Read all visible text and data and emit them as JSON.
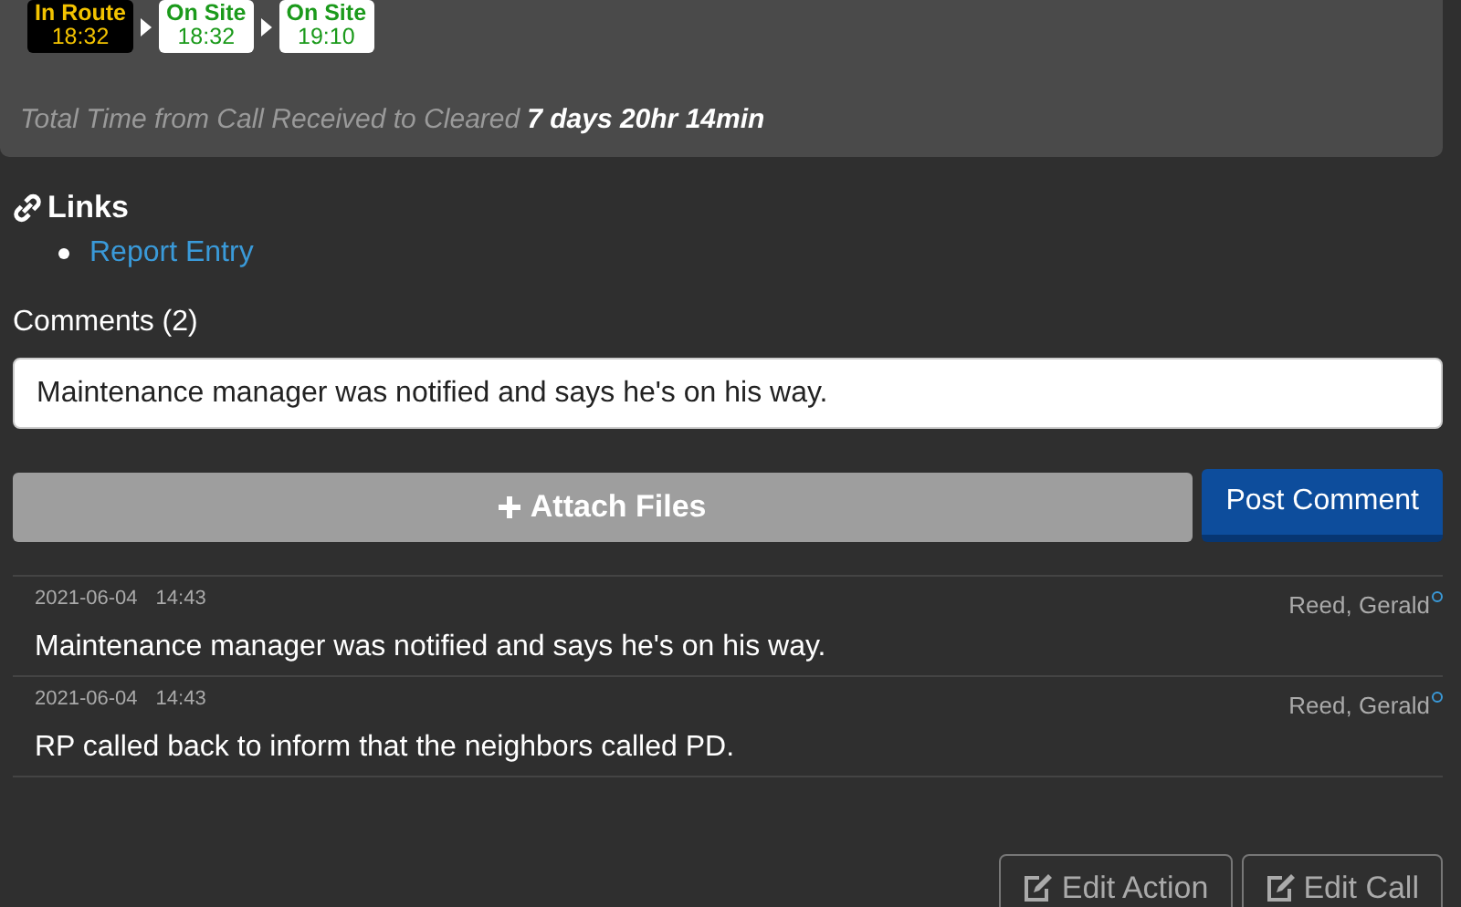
{
  "status_chain": [
    {
      "kind": "in-route",
      "label": "In Route",
      "time": "18:32"
    },
    {
      "kind": "on-site",
      "label": "On Site",
      "time": "18:32"
    },
    {
      "kind": "on-site",
      "label": "On Site",
      "time": "19:10"
    }
  ],
  "total_time": {
    "label": "Total Time from Call Received to Cleared",
    "value": "7 days 20hr 14min"
  },
  "links": {
    "title": "Links",
    "items": [
      "Report Entry"
    ]
  },
  "comments": {
    "title": "Comments (2)",
    "input_value": "Maintenance manager was notified and says he's on his way.",
    "attach_button": "Attach Files",
    "post_button": "Post Comment",
    "items": [
      {
        "date": "2021-06-04",
        "time": "14:43",
        "author": "Reed, Gerald",
        "text": "Maintenance manager was notified and says he's on his way."
      },
      {
        "date": "2021-06-04",
        "time": "14:43",
        "author": "Reed, Gerald",
        "text": "RP called back to inform that the neighbors called PD."
      }
    ]
  },
  "actions": [
    "Edit Action",
    "Edit Call"
  ]
}
